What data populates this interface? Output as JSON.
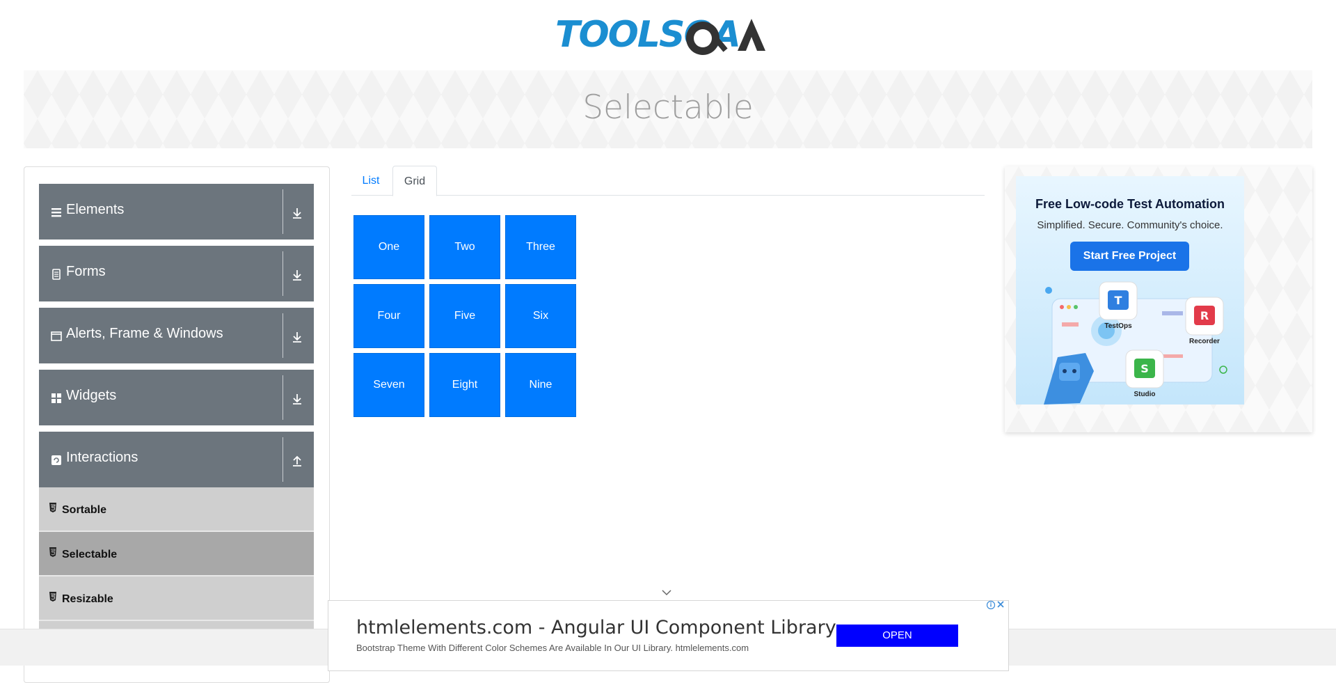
{
  "header": {
    "logo_text": "TOOLSQA"
  },
  "banner": {
    "title": "Selectable"
  },
  "sidebar": {
    "groups": [
      {
        "label": "Elements",
        "icon": "list-icon"
      },
      {
        "label": "Forms",
        "icon": "document-icon"
      },
      {
        "label": "Alerts, Frame & Windows",
        "icon": "window-icon"
      },
      {
        "label": "Widgets",
        "icon": "widgets-icon"
      },
      {
        "label": "Interactions",
        "icon": "refresh-icon"
      }
    ],
    "items": [
      {
        "label": "Sortable"
      },
      {
        "label": "Selectable"
      },
      {
        "label": "Resizable"
      }
    ]
  },
  "tabs": {
    "list": "List",
    "grid": "Grid"
  },
  "grid": [
    "One",
    "Two",
    "Three",
    "Four",
    "Five",
    "Six",
    "Seven",
    "Eight",
    "Nine"
  ],
  "ad_right": {
    "title": "Free Low-code Test Automation",
    "subtitle": "Simplified. Secure. Community's choice.",
    "cta": "Start Free Project",
    "apps": [
      "TestOps",
      "Recorder",
      "Studio"
    ]
  },
  "ad_bottom": {
    "headline": "htmlelements.com - Angular UI Component Library",
    "subline": "Bootstrap Theme With Different Color Schemes Are Available In Our UI Library. htmlelements.com",
    "button": "OPEN"
  },
  "colors": {
    "primary": "#007bff",
    "sidebar_group": "#6c757d",
    "item_active": "#a8a8a8"
  }
}
